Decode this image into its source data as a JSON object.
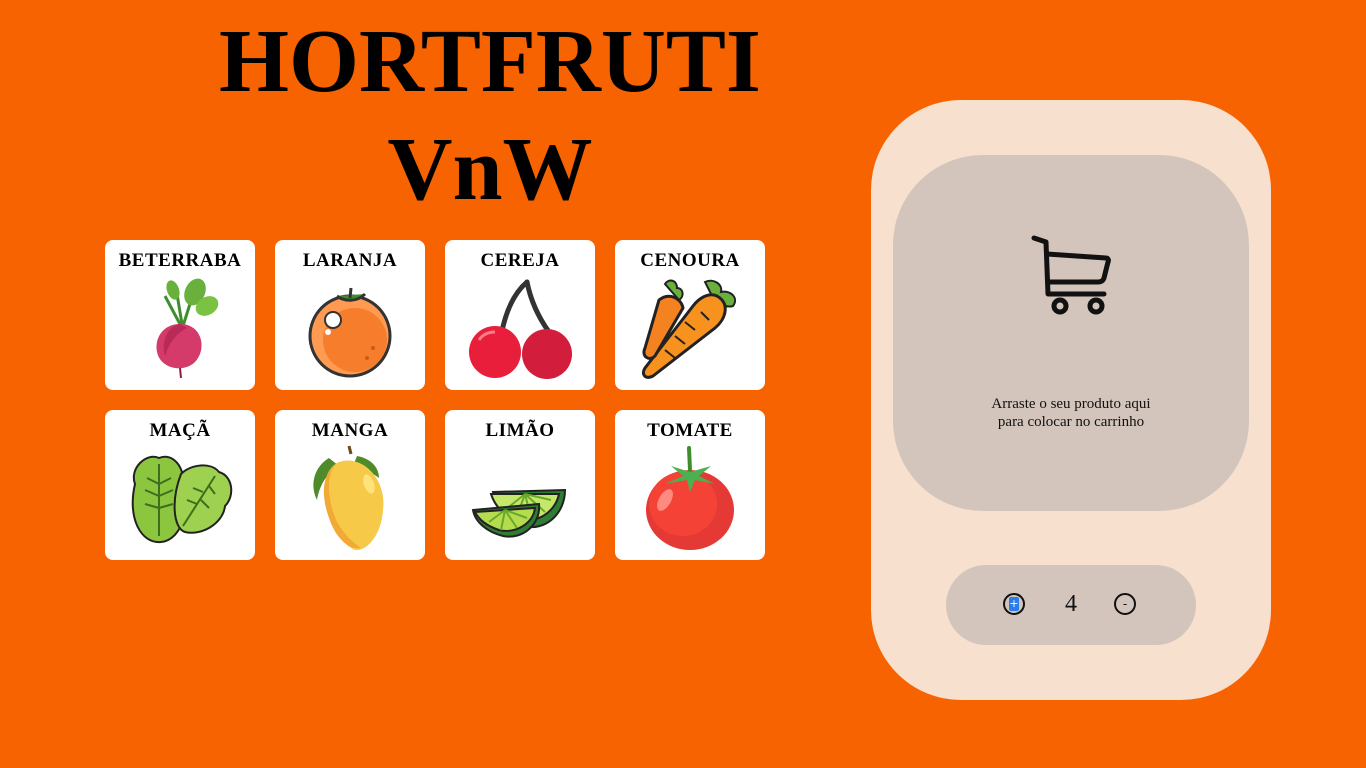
{
  "header": {
    "title_line1": "HORTFRUTI",
    "title_line2": "VnW"
  },
  "products": [
    {
      "label": "BETERRABA",
      "icon": "beet-icon"
    },
    {
      "label": "LARANJA",
      "icon": "orange-icon"
    },
    {
      "label": "CEREJA",
      "icon": "cherry-icon"
    },
    {
      "label": "CENOURA",
      "icon": "carrot-icon"
    },
    {
      "label": "MAÇÃ",
      "icon": "lettuce-icon"
    },
    {
      "label": "MANGA",
      "icon": "mango-icon"
    },
    {
      "label": "LIMÃO",
      "icon": "lime-icon"
    },
    {
      "label": "TOMATE",
      "icon": "tomato-icon"
    }
  ],
  "cart": {
    "icon": "cart-icon",
    "drop_text_line1": "Arraste o seu produto aqui",
    "drop_text_line2": "para colocar no carrinho",
    "quantity": "4",
    "plus_label": "+",
    "minus_label": "-"
  },
  "colors": {
    "background": "#f76300",
    "panel": "#f8e0cf",
    "dropzone": "#d4c5bc",
    "card": "#ffffff"
  }
}
